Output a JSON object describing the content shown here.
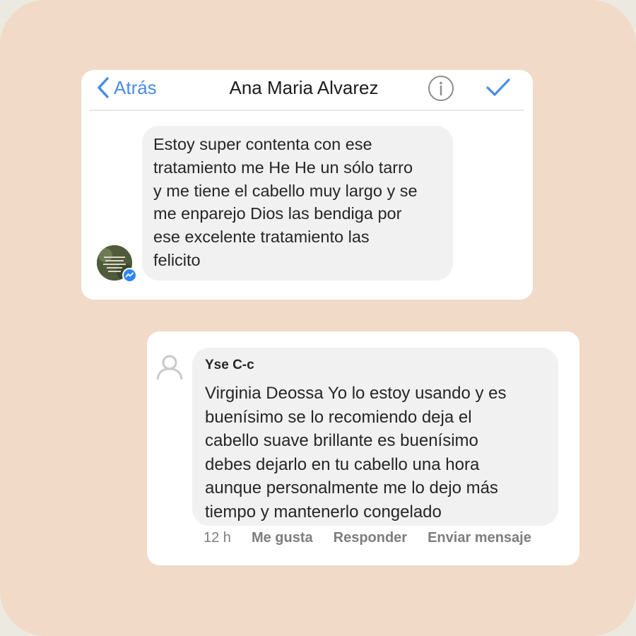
{
  "messenger": {
    "back_label": "Atrás",
    "contact_name": "Ana Maria Alvarez",
    "icons": {
      "back": "chevron-left-icon",
      "info": "info-circle-icon",
      "done": "checkmark-icon"
    },
    "message": "Estoy super contenta con ese\ntratamiento me He He un sólo tarro\ny me tiene el cabello muy largo y se\nme enparejo Dios las bendiga por\nese excelente tratamiento las\nfelicito",
    "accent_color": "#4A8BE8"
  },
  "comment": {
    "author": "Yse C-c",
    "text": "Virginia Deossa Yo lo estoy usando y es\nbuenísimo se lo recomiendo deja el\ncabello suave brillante es buenísimo\ndebes dejarlo en tu cabello una hora\naunque personalmente me lo dejo más\ntiempo y mantenerlo congelado",
    "time": "12 h",
    "actions": {
      "like": "Me gusta",
      "reply": "Responder",
      "message": "Enviar mensaje"
    }
  },
  "background_color": "#F1DAC8"
}
